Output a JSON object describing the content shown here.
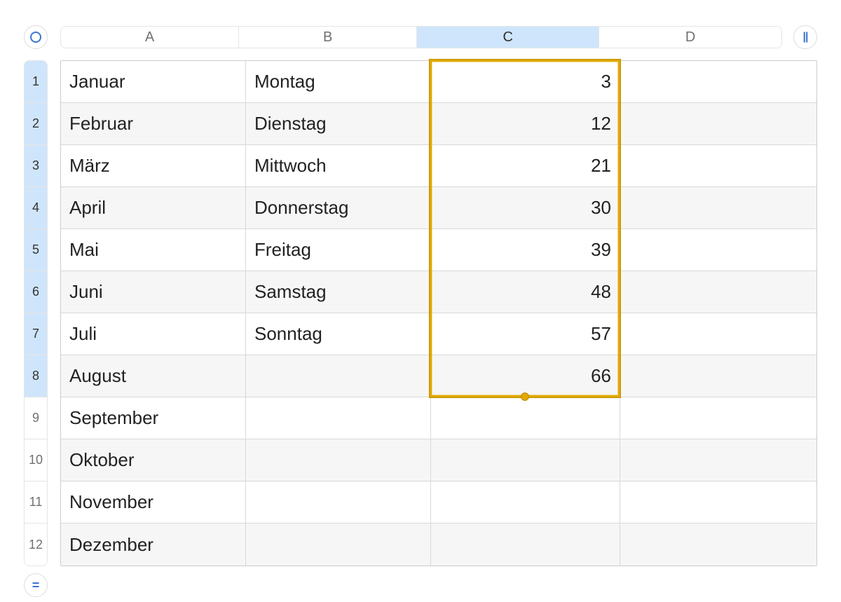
{
  "columns": [
    "A",
    "B",
    "C",
    "D"
  ],
  "selected_column_index": 2,
  "row_count": 12,
  "selected_row_range": [
    1,
    8
  ],
  "selection": {
    "col_start": 2,
    "col_end": 2,
    "row_start": 1,
    "row_end": 8
  },
  "cells": {
    "A": [
      "Januar",
      "Februar",
      "März",
      "April",
      "Mai",
      "Juni",
      "Juli",
      "August",
      "September",
      "Oktober",
      "November",
      "Dezember"
    ],
    "B": [
      "Montag",
      "Dienstag",
      "Mittwoch",
      "Donnerstag",
      "Freitag",
      "Samstag",
      "Sonntag",
      "",
      "",
      "",
      "",
      ""
    ],
    "C": [
      "3",
      "12",
      "21",
      "30",
      "39",
      "48",
      "57",
      "66",
      "",
      "",
      "",
      ""
    ],
    "D": [
      "",
      "",
      "",
      "",
      "",
      "",
      "",
      "",
      "",
      "",
      "",
      ""
    ]
  },
  "icons": {
    "corner": "circle-icon",
    "right": "columns-icon",
    "bottom": "equals-icon"
  }
}
